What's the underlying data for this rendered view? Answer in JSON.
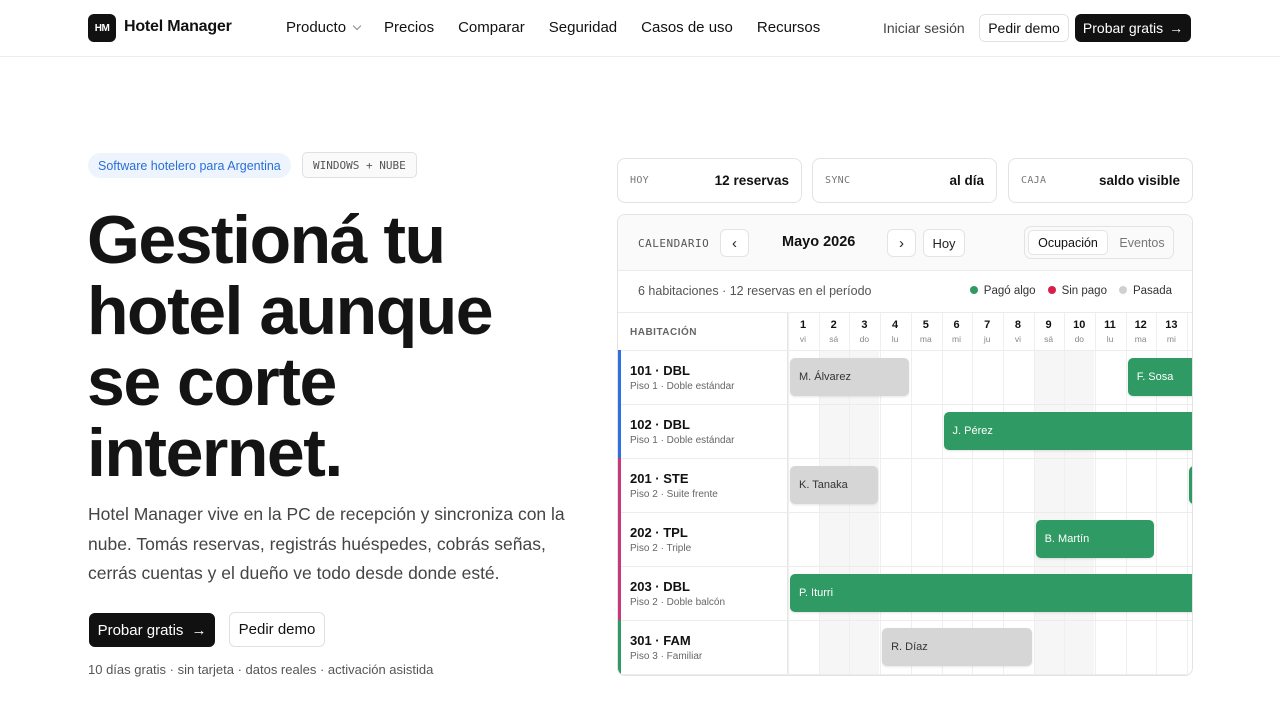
{
  "nav": {
    "logo_mark": "HM",
    "brand": "Hotel Manager",
    "links": [
      "Producto",
      "Precios",
      "Comparar",
      "Seguridad",
      "Casos de uso",
      "Recursos"
    ],
    "login": "Iniciar sesión",
    "demo": "Pedir demo",
    "try": "Probar gratis",
    "try_arrow": "→"
  },
  "hero": {
    "badge": "Software hotelero para Argentina",
    "platform_badge": "WINDOWS + NUBE",
    "headline": [
      "Gestioná tu",
      "hotel aunque",
      "se corte",
      "internet."
    ],
    "subtitle": "Hotel Manager vive en la PC de recepción y sincroniza con la nube. Tomás reservas, registrás huéspedes, cobrás señas, cerrás cuentas y el dueño ve todo desde donde esté.",
    "cta_primary": "Probar gratis",
    "cta_arrow": "→",
    "cta_secondary": "Pedir demo",
    "footnote": "10 días gratis · sin tarjeta · datos reales · activación asistida"
  },
  "stats": [
    {
      "label": "HOY",
      "value": "12 reservas"
    },
    {
      "label": "SYNC",
      "value": "al día"
    },
    {
      "label": "CAJA",
      "value": "saldo visible"
    }
  ],
  "calendar": {
    "title": "CALENDARIO",
    "prev": "‹",
    "next": "›",
    "month": "Mayo 2026",
    "today": "Hoy",
    "view_active": "Ocupación",
    "view_other": "Eventos",
    "summary": "6 habitaciones · 12 reservas en el período",
    "legend": [
      {
        "label": "Pagó algo",
        "color": "#2f9a63"
      },
      {
        "label": "Sin pago",
        "color": "#d81f4a"
      },
      {
        "label": "Pasada",
        "color": "#d0d0d0"
      }
    ],
    "room_header": "HABITACIÓN",
    "days": [
      {
        "n": "1",
        "w": "vi"
      },
      {
        "n": "2",
        "w": "sá"
      },
      {
        "n": "3",
        "w": "do"
      },
      {
        "n": "4",
        "w": "lu"
      },
      {
        "n": "5",
        "w": "ma"
      },
      {
        "n": "6",
        "w": "mi"
      },
      {
        "n": "7",
        "w": "ju"
      },
      {
        "n": "8",
        "w": "vi"
      },
      {
        "n": "9",
        "w": "sá"
      },
      {
        "n": "10",
        "w": "do"
      },
      {
        "n": "11",
        "w": "lu"
      },
      {
        "n": "12",
        "w": "ma"
      },
      {
        "n": "13",
        "w": "mi"
      }
    ],
    "rooms": [
      {
        "name": "101 · DBL",
        "sub": "Piso 1 · Doble estándar",
        "color": "#2f6fe0"
      },
      {
        "name": "102 · DBL",
        "sub": "Piso 1 · Doble estándar",
        "color": "#2f6fe0"
      },
      {
        "name": "201 · STE",
        "sub": "Piso 2 · Suite frente",
        "color": "#c9387f"
      },
      {
        "name": "202 · TPL",
        "sub": "Piso 2 · Triple",
        "color": "#c9387f"
      },
      {
        "name": "203 · DBL",
        "sub": "Piso 2 · Doble balcón",
        "color": "#c9387f"
      },
      {
        "name": "301 · FAM",
        "sub": "Piso 3 · Familiar",
        "color": "#2f9a63"
      }
    ],
    "reservations": [
      {
        "guest": "M. Álvarez",
        "room": 0,
        "start": 1,
        "end": 4,
        "status": "pasada"
      },
      {
        "guest": "F. Sosa",
        "room": 0,
        "start": 12,
        "end": 13,
        "status": "pago"
      },
      {
        "guest": "J. Pérez",
        "room": 1,
        "start": 6,
        "end": 13,
        "status": "pago"
      },
      {
        "guest": "K. Tanaka",
        "room": 2,
        "start": 1,
        "end": 3,
        "status": "pasada"
      },
      {
        "guest": "",
        "room": 2,
        "start": 14,
        "end": 14,
        "status": "pago"
      },
      {
        "guest": "B. Martín",
        "room": 3,
        "start": 9,
        "end": 12,
        "status": "pago"
      },
      {
        "guest": "P. Iturri",
        "room": 4,
        "start": 1,
        "end": 13,
        "status": "pago"
      },
      {
        "guest": "R. Díaz",
        "room": 5,
        "start": 4,
        "end": 8,
        "status": "pasada"
      }
    ]
  }
}
